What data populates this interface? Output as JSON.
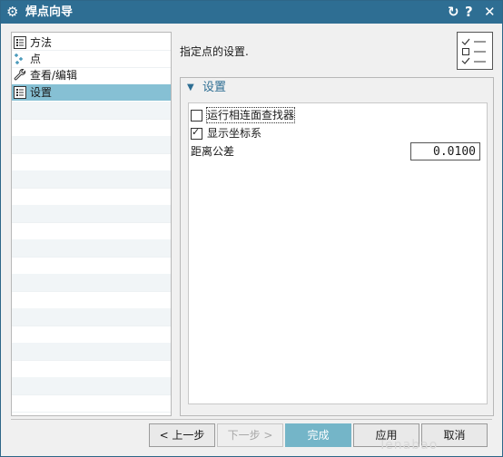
{
  "window": {
    "title": "焊点向导",
    "icons": {
      "app": "gear-icon",
      "reset": "reset-icon",
      "help": "help-icon",
      "close": "close-icon"
    },
    "title_bar_color": "#2e6e93"
  },
  "sidebar": {
    "items": [
      {
        "label": "方法",
        "icon": "list-icon",
        "selected": false
      },
      {
        "label": "点",
        "icon": "points-icon",
        "selected": false
      },
      {
        "label": "查看/编辑",
        "icon": "wrench-icon",
        "selected": false
      },
      {
        "label": "设置",
        "icon": "list-icon",
        "selected": true
      }
    ],
    "selected_color": "#86c0d4"
  },
  "main": {
    "prompt": "指定点的设置.",
    "group": {
      "title": "设置",
      "options": [
        {
          "label": "运行相连面查找器",
          "checked": false
        },
        {
          "label": "显示坐标系",
          "checked": true
        }
      ],
      "distance": {
        "label": "距离公差",
        "value": "0.0100"
      }
    }
  },
  "buttons": {
    "prev": "< 上一步",
    "next": "下一步 >",
    "finish": "完成",
    "apply": "应用",
    "cancel": "取消"
  },
  "watermark": "Tenabao"
}
